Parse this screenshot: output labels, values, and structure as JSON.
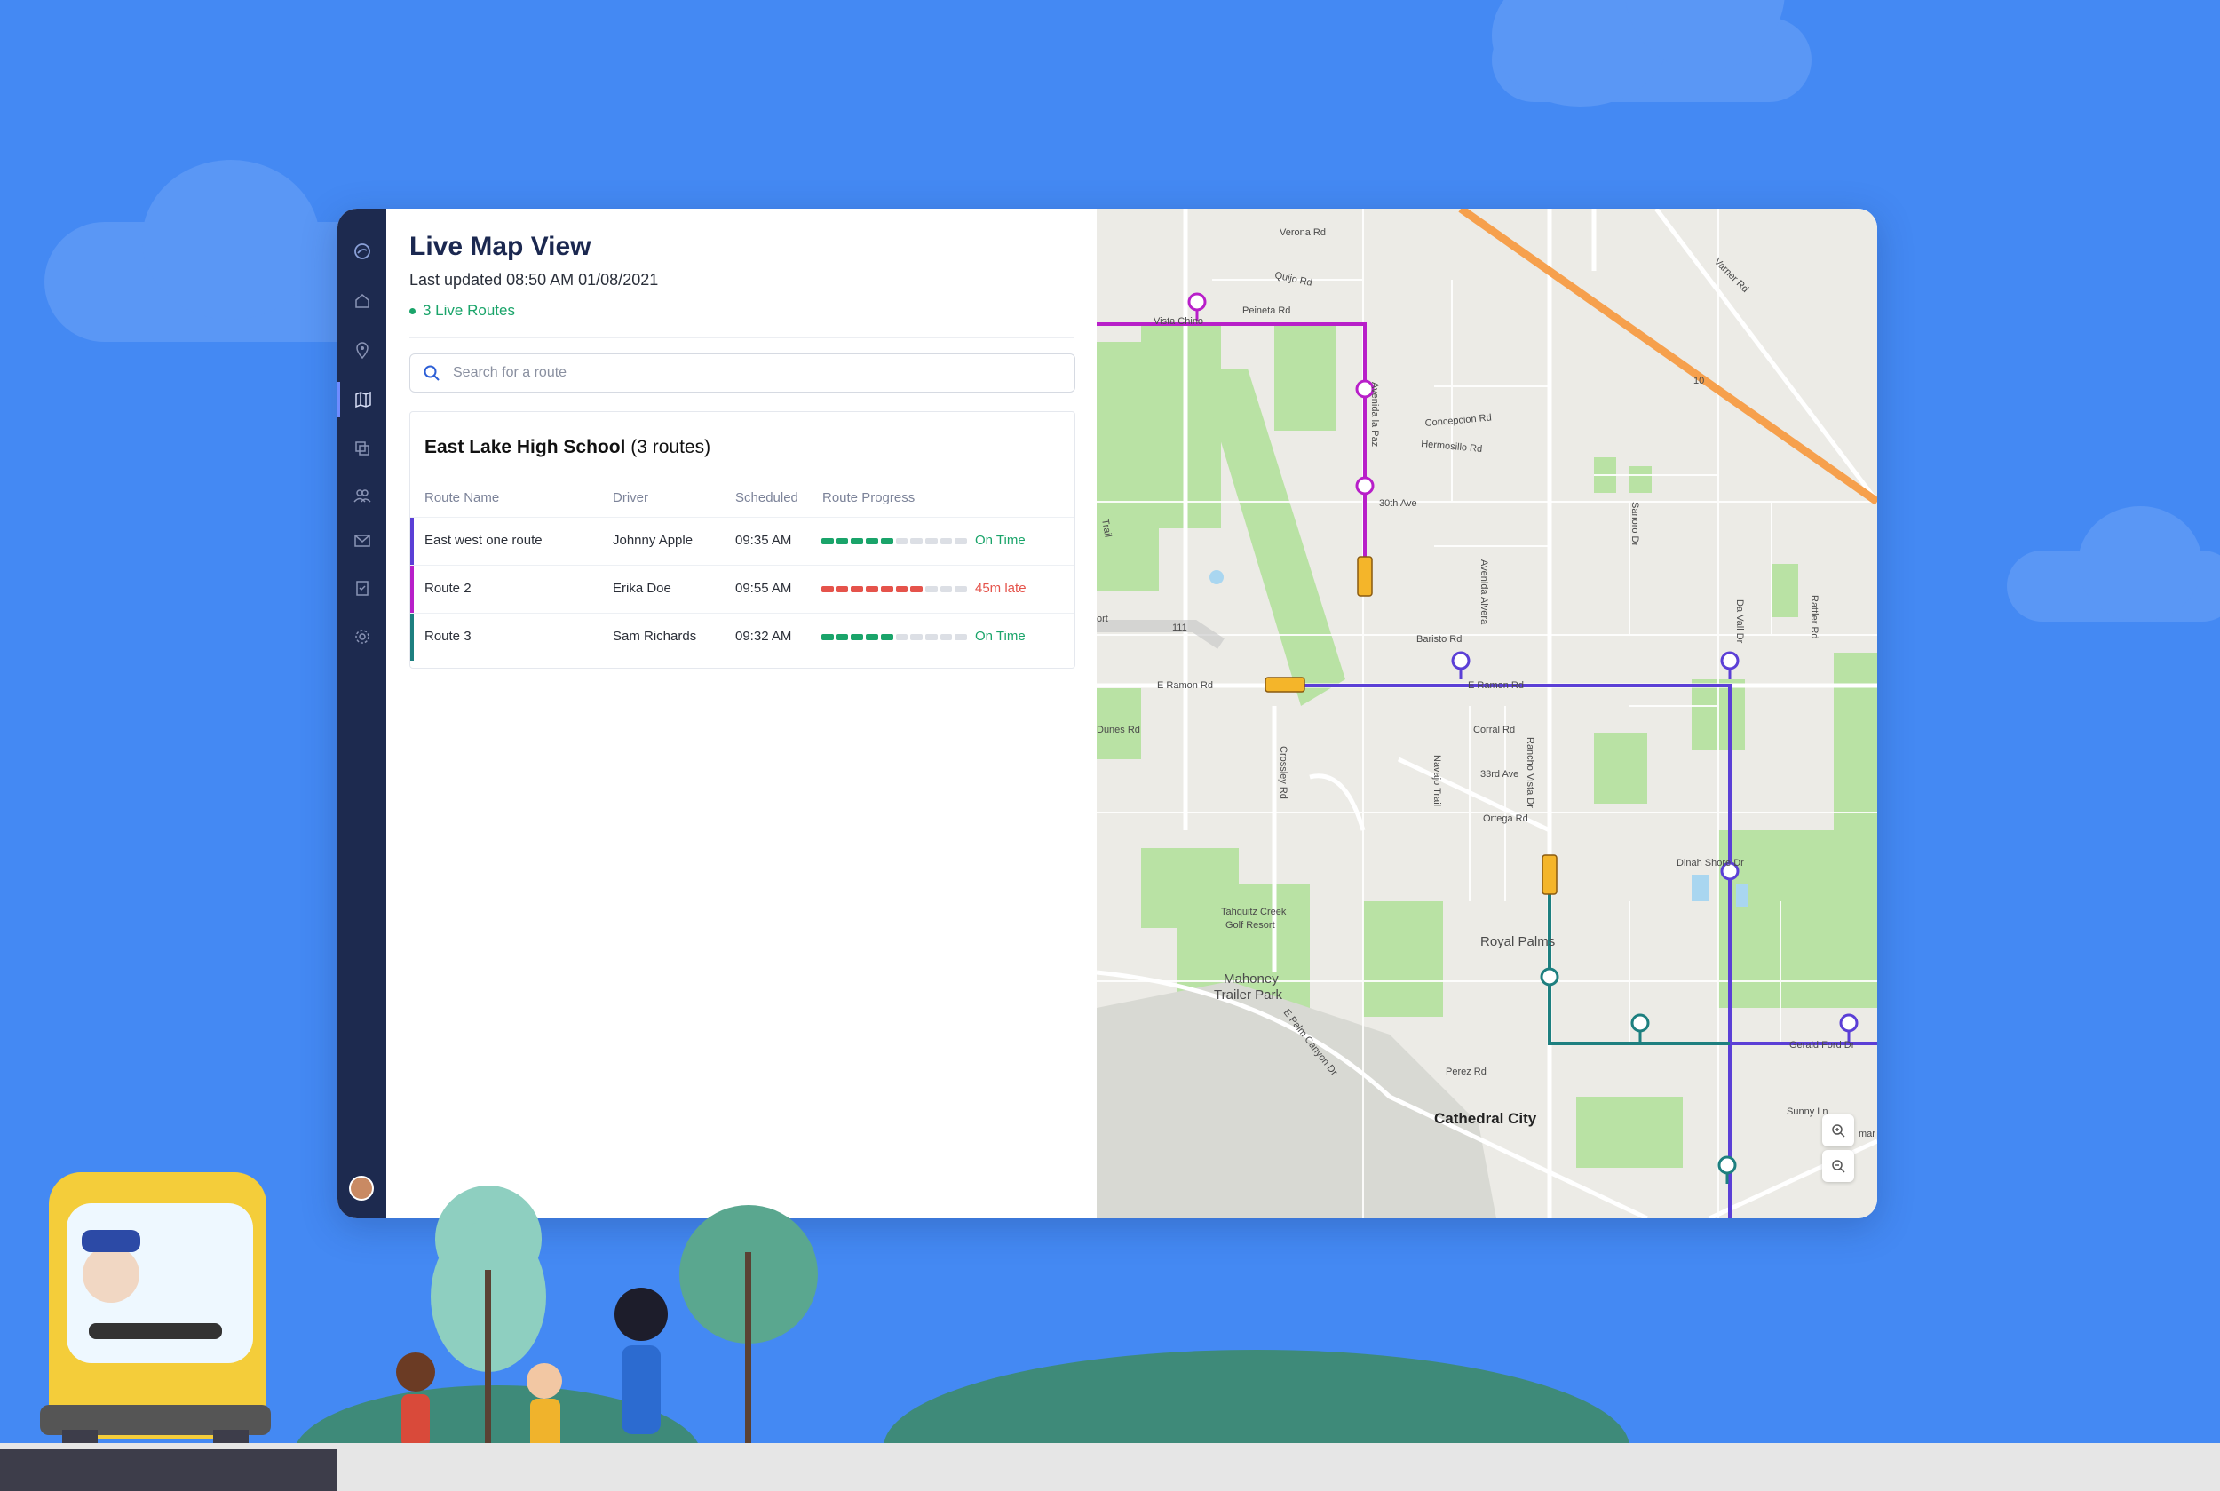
{
  "header": {
    "title": "Live Map View",
    "last_updated": "Last updated 08:50 AM 01/08/2021",
    "live_routes": "3 Live Routes"
  },
  "search": {
    "placeholder": "Search for a route"
  },
  "school": {
    "name": "East Lake High School",
    "count": "(3 routes)"
  },
  "table": {
    "headers": [
      "Route Name",
      "Driver",
      "Scheduled",
      "Route Progress"
    ],
    "rows": [
      {
        "name": "East west one route",
        "driver": "Johnny Apple",
        "scheduled": "09:35 AM",
        "progress": 0.5,
        "status": "On Time",
        "color": "#5b3fd6",
        "status_color": "#1aa46a"
      },
      {
        "name": "Route 2",
        "driver": "Erika Doe",
        "scheduled": "09:55 AM",
        "progress": 0.65,
        "status": "45m late",
        "color": "#b81fc9",
        "status_color": "#e5534b"
      },
      {
        "name": "Route 3",
        "driver": "Sam Richards",
        "scheduled": "09:32 AM",
        "progress": 0.5,
        "status": "On Time",
        "color": "#1d7f7f",
        "status_color": "#1aa46a"
      }
    ]
  },
  "map": {
    "labels": {
      "verona": "Verona Rd",
      "quijo": "Quijo Rd",
      "peineta": "Peineta Rd",
      "vista": "Vista Chino",
      "paz": "Avenida la Paz",
      "concepcion": "Concepcion Rd",
      "hermosillo": "Hermosillo Rd",
      "ave30": "30th Ave",
      "sanoro": "Sanoro Dr",
      "varner": "Varner Rd",
      "barisito": "Baristo Rd",
      "alvera": "Avenida Alvera",
      "davall": "Da Vall Dr",
      "rattler": "Rattler Rd",
      "ramon_w": "E Ramon Rd",
      "ramon_e": "E Ramon Rd",
      "dunes": "Dunes Rd",
      "corral": "Corral Rd",
      "ave33": "33rd Ave",
      "ortega": "Ortega Rd",
      "crossley": "Crossley Rd",
      "navajo": "Navajo Trail",
      "rancho": "Rancho Vista Dr",
      "dinah": "Dinah Shore Dr",
      "tahquitz": "Tahquitz Creek",
      "golf": "Golf Resort",
      "royal": "Royal Palms",
      "mahoney": "Mahoney",
      "trailer": "Trailer Park",
      "palmcanyon": "E Palm Canyon Dr",
      "perez": "Perez Rd",
      "cathedral": "Cathedral City",
      "sunny": "Sunny Ln",
      "gerald": "Gerald Ford Dr",
      "hw111": "111",
      "hw10": "10",
      "trail": "Trail",
      "ort": "ort",
      "mar": "mar"
    },
    "colors": {
      "route1": "#5b3fd6",
      "route2": "#b81fc9",
      "route3": "#1d7f7f",
      "freeway": "#f6a04d",
      "park": "#b9e2a4"
    }
  },
  "icons": [
    "logo-icon",
    "home-icon",
    "location-icon",
    "map-icon",
    "copy-icon",
    "users-icon",
    "mail-icon",
    "clipboard-icon",
    "settings-icon",
    "search-icon",
    "zoom-in-icon",
    "zoom-out-icon"
  ]
}
